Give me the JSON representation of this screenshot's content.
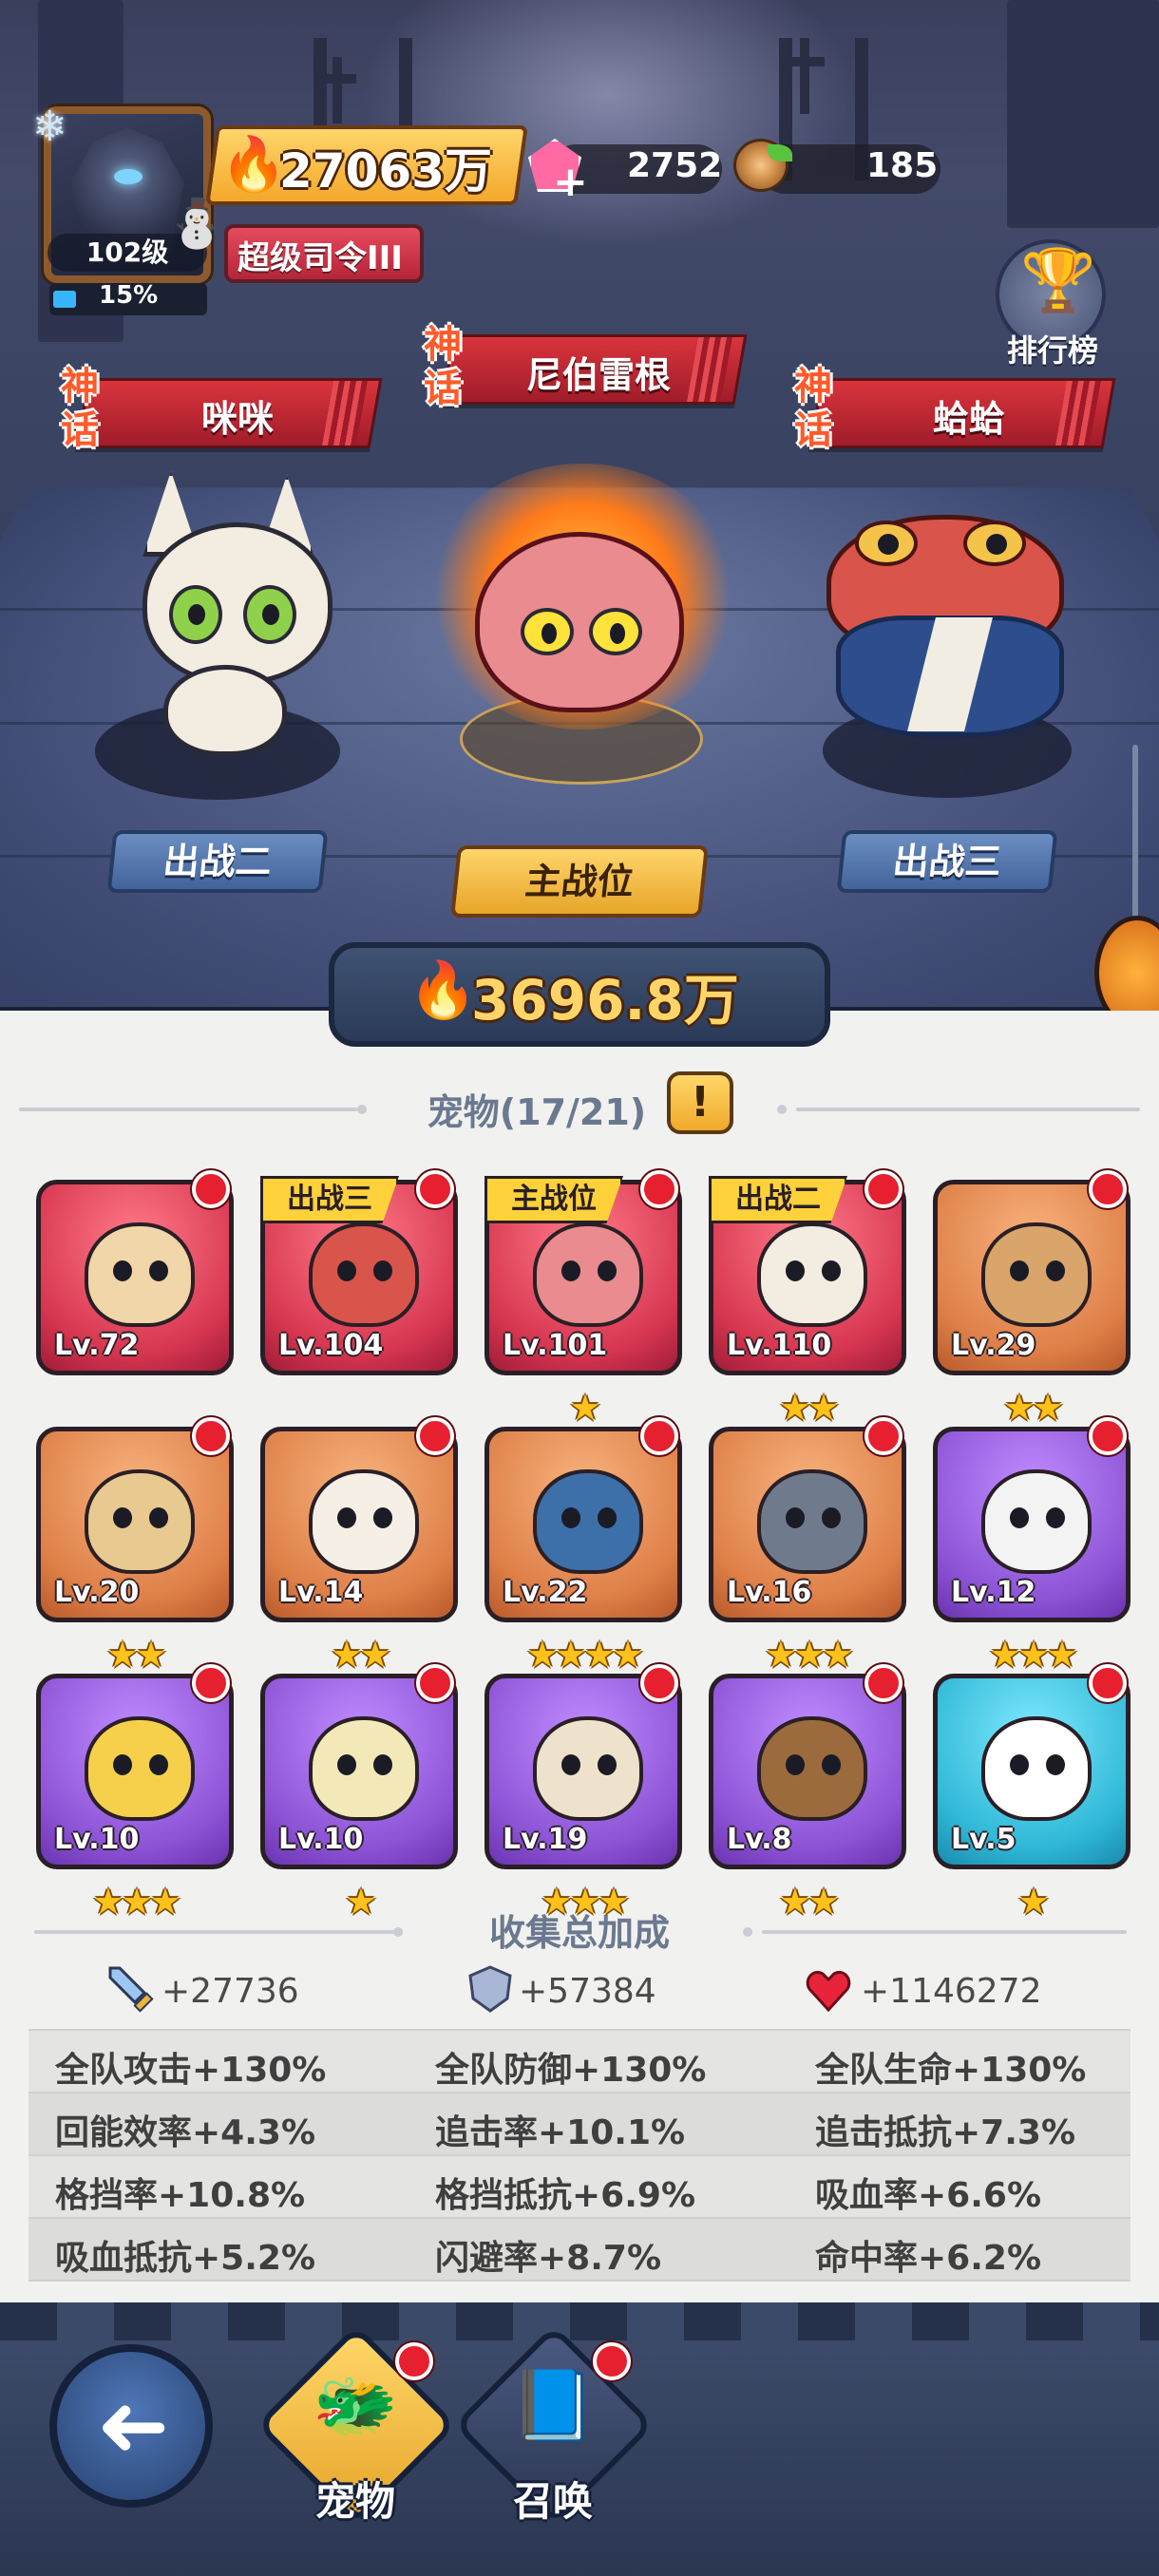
{
  "player": {
    "level": "102级",
    "exp_percent": "15%",
    "exp_fraction": 0.15,
    "power": "27063万",
    "rank_title": "超级司令III"
  },
  "currencies": {
    "gems": "2752",
    "wood": "185"
  },
  "leaderboard_label": "排行榜",
  "team": {
    "tier_label": "神话",
    "slots": [
      {
        "name": "咪咪",
        "button": "出战二"
      },
      {
        "name": "尼伯雷根",
        "button": "主战位"
      },
      {
        "name": "蛤蛤",
        "button": "出战三"
      }
    ],
    "power": "3696.8万"
  },
  "pets_header": "宠物(17/21)",
  "pets": [
    {
      "level": "Lv.72",
      "color": "red",
      "tag": "",
      "stars": ""
    },
    {
      "level": "Lv.104",
      "color": "red",
      "tag": "出战三",
      "stars": ""
    },
    {
      "level": "Lv.101",
      "color": "red",
      "tag": "主战位",
      "stars": "★"
    },
    {
      "level": "Lv.110",
      "color": "red",
      "tag": "出战二",
      "stars": "★★"
    },
    {
      "level": "Lv.29",
      "color": "orange",
      "tag": "",
      "stars": "★★"
    },
    {
      "level": "Lv.20",
      "color": "orange",
      "tag": "",
      "stars": "★★"
    },
    {
      "level": "Lv.14",
      "color": "orange",
      "tag": "",
      "stars": "★★"
    },
    {
      "level": "Lv.22",
      "color": "orange",
      "tag": "",
      "stars": "★★★★"
    },
    {
      "level": "Lv.16",
      "color": "orange",
      "tag": "",
      "stars": "★★★"
    },
    {
      "level": "Lv.12",
      "color": "purple",
      "tag": "",
      "stars": "★★★"
    },
    {
      "level": "Lv.10",
      "color": "purple",
      "tag": "",
      "stars": "★★★"
    },
    {
      "level": "Lv.10",
      "color": "purple",
      "tag": "",
      "stars": "★"
    },
    {
      "level": "Lv.19",
      "color": "purple",
      "tag": "",
      "stars": "★★★"
    },
    {
      "level": "Lv.8",
      "color": "purple",
      "tag": "",
      "stars": "★★"
    },
    {
      "level": "Lv.5",
      "color": "cyan",
      "tag": "",
      "stars": "★"
    }
  ],
  "bonus_header": "收集总加成",
  "bonus_totals": {
    "attack": "+27736",
    "defense": "+57384",
    "health": "+1146272"
  },
  "stats": [
    [
      "全队攻击+130%",
      "全队防御+130%",
      "全队生命+130%"
    ],
    [
      "回能效率+4.3%",
      "追击率+10.1%",
      "追击抵抗+7.3%"
    ],
    [
      "格挡率+10.8%",
      "格挡抵抗+6.9%",
      "吸血率+6.6%"
    ],
    [
      "吸血抵抗+5.2%",
      "闪避率+8.7%",
      "命中率+6.2%"
    ]
  ],
  "nav": {
    "pets": "宠物",
    "summon": "召唤"
  },
  "icons": {
    "fire": "🔥",
    "trophy": "🏆",
    "snowflake": "❄",
    "snowman": "⛄",
    "back": "➦",
    "warning": "!"
  },
  "colors": {
    "card_red": "#d73650",
    "card_orange": "#de7f48",
    "card_purple": "#8c54d6",
    "card_cyan": "#2fb8d6",
    "notify_dot": "#e6202e",
    "gold": "#ffd56a"
  }
}
